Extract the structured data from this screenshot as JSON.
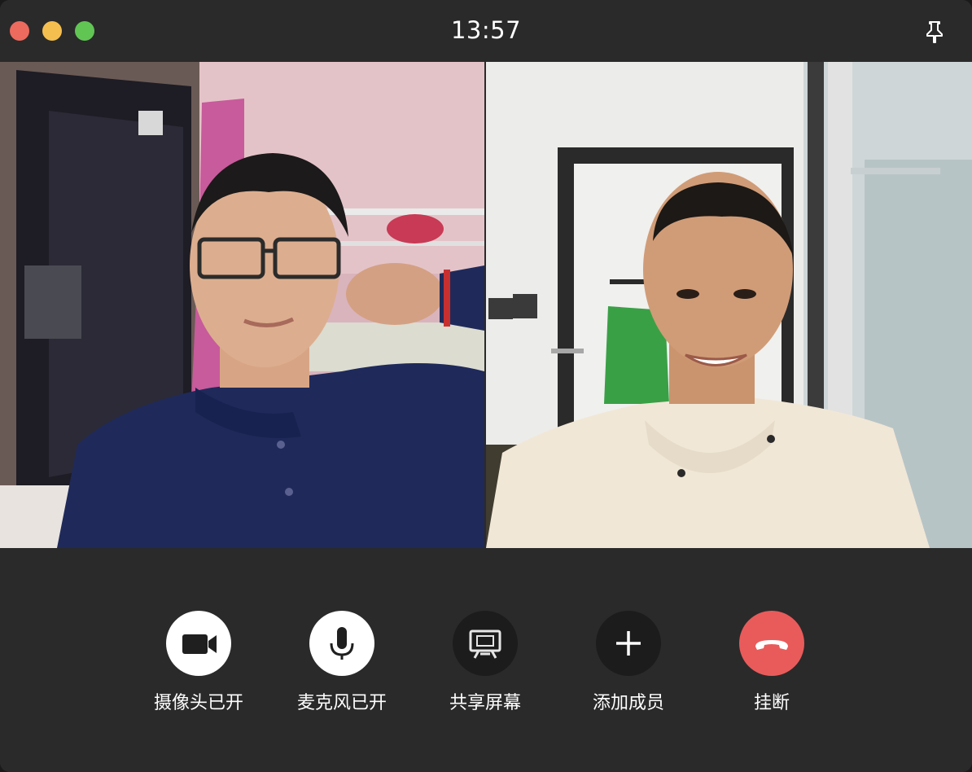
{
  "window": {
    "clock": "13:57",
    "pin_icon": "pin-icon"
  },
  "participants": [
    {
      "name_hint": "",
      "tile": "left"
    },
    {
      "name_hint": "",
      "tile": "right"
    }
  ],
  "controls": {
    "camera": {
      "label": "摄像头已开",
      "icon": "video-camera-icon"
    },
    "microphone": {
      "label": "麦克风已开",
      "icon": "microphone-icon"
    },
    "share": {
      "label": "共享屏幕",
      "icon": "screen-share-icon"
    },
    "add": {
      "label": "添加成员",
      "icon": "plus-icon"
    },
    "hangup": {
      "label": "挂断",
      "icon": "hangup-phone-icon"
    }
  },
  "colors": {
    "titlebar": "#2a2a2a",
    "close": "#ed6a5e",
    "minimize": "#f5bf4f",
    "maximize": "#61c554",
    "hangup": "#e95b5b"
  }
}
